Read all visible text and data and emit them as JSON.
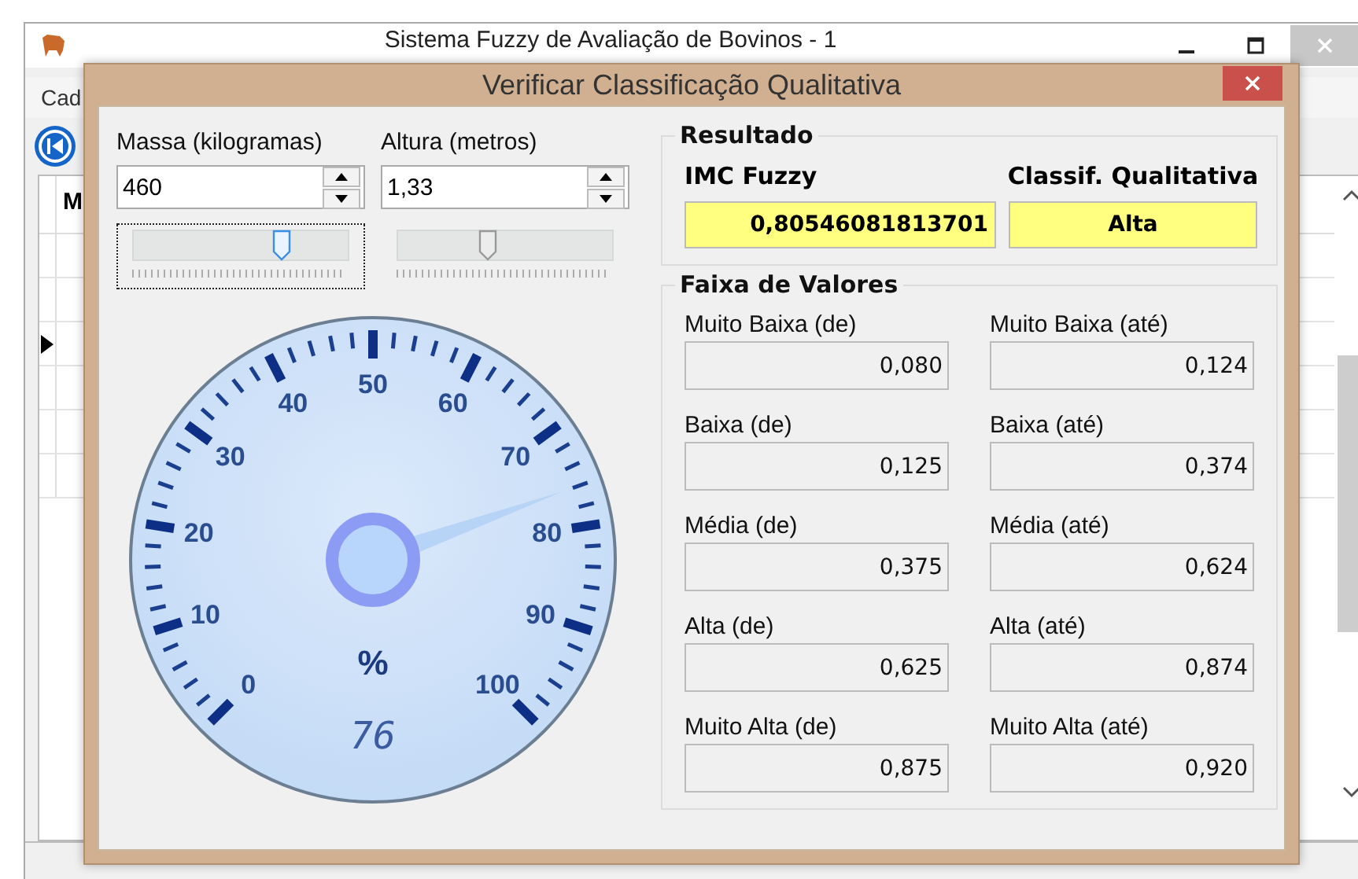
{
  "background_window": {
    "title": "Sistema Fuzzy de Avaliação de Bovinos - 1",
    "menu": [
      "Cad"
    ],
    "grid": {
      "columns": [
        "M"
      ]
    }
  },
  "dialog": {
    "title": "Verificar Classificação Qualitativa"
  },
  "inputs": [
    {
      "label": "Massa (kilogramas)",
      "value": "460",
      "slider": {
        "level": 0.69,
        "focused": true
      }
    },
    {
      "label": "Altura (metros)",
      "value": "1,33",
      "slider": {
        "level": 0.42,
        "focused": false
      }
    }
  ],
  "gauge": {
    "labels": [
      "0",
      "10",
      "20",
      "30",
      "40",
      "50",
      "60",
      "70",
      "80",
      "90",
      "100"
    ],
    "unit": "%",
    "readout": "76",
    "level": 0.76
  },
  "result": {
    "title": "Resultado",
    "fields": [
      {
        "label": "IMC Fuzzy",
        "value": "0,80546081813701"
      },
      {
        "label": "Classif. Qualitativa",
        "value": "Alta"
      }
    ]
  },
  "ranges": {
    "title": "Faixa de Valores",
    "fields": [
      {
        "label": "Muito Baixa (de)",
        "value": "0,080"
      },
      {
        "label": "Muito Baixa (até)",
        "value": "0,124"
      },
      {
        "label": "Baixa (de)",
        "value": "0,125"
      },
      {
        "label": "Baixa (até)",
        "value": "0,374"
      },
      {
        "label": "Média (de)",
        "value": "0,375"
      },
      {
        "label": "Média (até)",
        "value": "0,624"
      },
      {
        "label": "Alta (de)",
        "value": "0,625"
      },
      {
        "label": "Alta (até)",
        "value": "0,874"
      },
      {
        "label": "Muito Alta (de)",
        "value": "0,875"
      },
      {
        "label": "Muito Alta (até)",
        "value": "0,920"
      }
    ]
  }
}
